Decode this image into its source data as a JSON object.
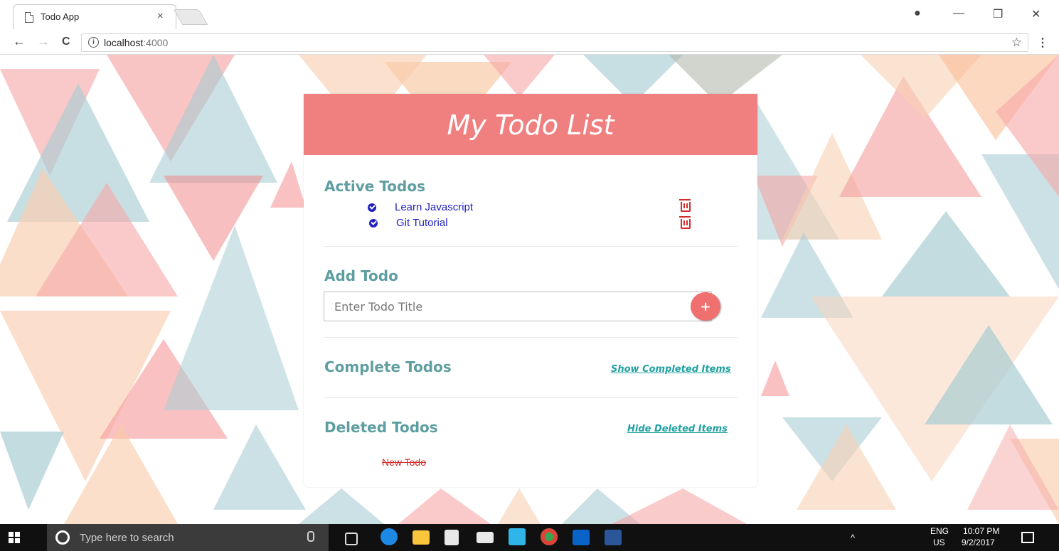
{
  "browser": {
    "tab_title": "Todo App",
    "tab_close": "×",
    "url_host": "localhost",
    "url_port": ":4000",
    "back_glyph": "←",
    "forward_glyph": "→",
    "reload_glyph": "C",
    "info_glyph": "i",
    "star_glyph": "☆",
    "menu_glyph": "⋮",
    "profile_glyph": "●",
    "minimize_glyph": "—",
    "restore_glyph": "❐",
    "close_glyph": "✕"
  },
  "app": {
    "title": "My Todo List",
    "active": {
      "heading": "Active Todos",
      "items": [
        {
          "label": "Learn Javascript"
        },
        {
          "label": "Git Tutorial"
        }
      ]
    },
    "add": {
      "heading": "Add Todo",
      "placeholder": "Enter Todo Title",
      "button_label": "+"
    },
    "complete": {
      "heading": "Complete Todos",
      "toggle_label": "Show Completed Items"
    },
    "deleted": {
      "heading": "Deleted Todos",
      "toggle_label": "Hide Deleted Items",
      "items": [
        {
          "label": "New Todo"
        }
      ]
    }
  },
  "taskbar": {
    "search_placeholder": "Type here to search",
    "language": "ENG",
    "region": "US",
    "time": "10:07 PM",
    "date": "9/2/2017"
  },
  "colors": {
    "header": "#f08080",
    "heading": "#5f9ea0",
    "todo_text": "#1f1fbf",
    "trash": "#d62b2b",
    "link": "#20a0a0"
  },
  "icons": [
    "page-icon",
    "close-icon",
    "back-arrow-icon",
    "forward-arrow-icon",
    "reload-icon",
    "info-icon",
    "star-icon",
    "menu-dots-icon",
    "check-circle-icon",
    "trash-icon",
    "plus-icon",
    "windows-start-icon",
    "cortana-icon",
    "microphone-icon"
  ]
}
